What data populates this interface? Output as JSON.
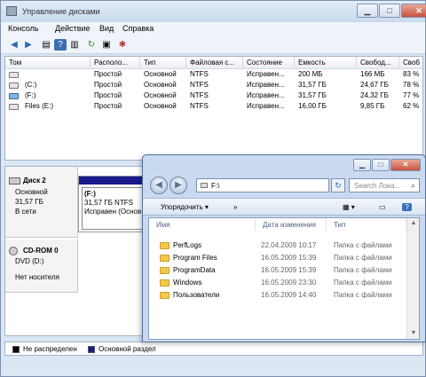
{
  "main_window": {
    "title": "Управление дисками",
    "buttons": {
      "minimize": "▁",
      "maximize": "□",
      "close": "✕"
    }
  },
  "menu": [
    "Консоль",
    "Действие",
    "Вид",
    "Справка"
  ],
  "toolbar_icons": [
    "back-arrow-icon",
    "forward-arrow-icon",
    "list-view-icon",
    "help-icon",
    "split-view-icon",
    "refresh-icon",
    "properties-icon",
    "settings-icon"
  ],
  "volumes": {
    "columns": [
      "Том",
      "Располо...",
      "Тип",
      "Файловая с...",
      "Состояние",
      "Емкость",
      "Свобод...",
      "Своб"
    ],
    "rows": [
      {
        "name": "",
        "layout": "Простой",
        "type": "Основной",
        "fs": "NTFS",
        "status": "Исправен...",
        "capacity": "200 МБ",
        "free": "166 МБ",
        "pct": "83 %"
      },
      {
        "name": "(C:)",
        "layout": "Простой",
        "type": "Основной",
        "fs": "NTFS",
        "status": "Исправен...",
        "capacity": "31,57 ГБ",
        "free": "24,67 ГБ",
        "pct": "78 %"
      },
      {
        "name": "(F:)",
        "layout": "Простой",
        "type": "Основной",
        "fs": "NTFS",
        "status": "Исправен...",
        "capacity": "31,57 ГБ",
        "free": "24,32 ГБ",
        "pct": "77 %"
      },
      {
        "name": "Files (E:)",
        "layout": "Простой",
        "type": "Основной",
        "fs": "NTFS",
        "status": "Исправен...",
        "capacity": "16,00 ГБ",
        "free": "9,85 ГБ",
        "pct": "62 %"
      }
    ]
  },
  "disks": [
    {
      "name": "Диск 2",
      "type": "Основной",
      "size": "31,57 ГБ",
      "state": "В сети"
    },
    {
      "name": "CD-ROM 0",
      "type": "DVD (D:)",
      "size": "",
      "state": "Нет носителя"
    }
  ],
  "partition": {
    "label": "(F:)",
    "size_fs": "31,57 ГБ NTFS",
    "status": "Исправен (Основ"
  },
  "legend": {
    "unallocated": "Не распределен",
    "primary": "Основной раздел",
    "unallocated_color": "#000000",
    "primary_color": "#1a1a8c"
  },
  "explorer": {
    "address": "F:\\",
    "search_placeholder": "Search Лока...",
    "organize": "Упорядочить ▾",
    "more": "»",
    "columns": [
      "Имя",
      "Дата изменения",
      "Тип"
    ],
    "files": [
      {
        "name": "PerfLogs",
        "date": "22.04.2009 10:17",
        "type": "Папка с файлами"
      },
      {
        "name": "Program Files",
        "date": "16.05.2009 15:39",
        "type": "Папка с файлами"
      },
      {
        "name": "ProgramData",
        "date": "16.05.2009 15:39",
        "type": "Папка с файлами"
      },
      {
        "name": "Windows",
        "date": "16.05.2009 23:30",
        "type": "Папка с файлами"
      },
      {
        "name": "Пользователи",
        "date": "16.05.2009 14:40",
        "type": "Папка с файлами"
      }
    ]
  }
}
